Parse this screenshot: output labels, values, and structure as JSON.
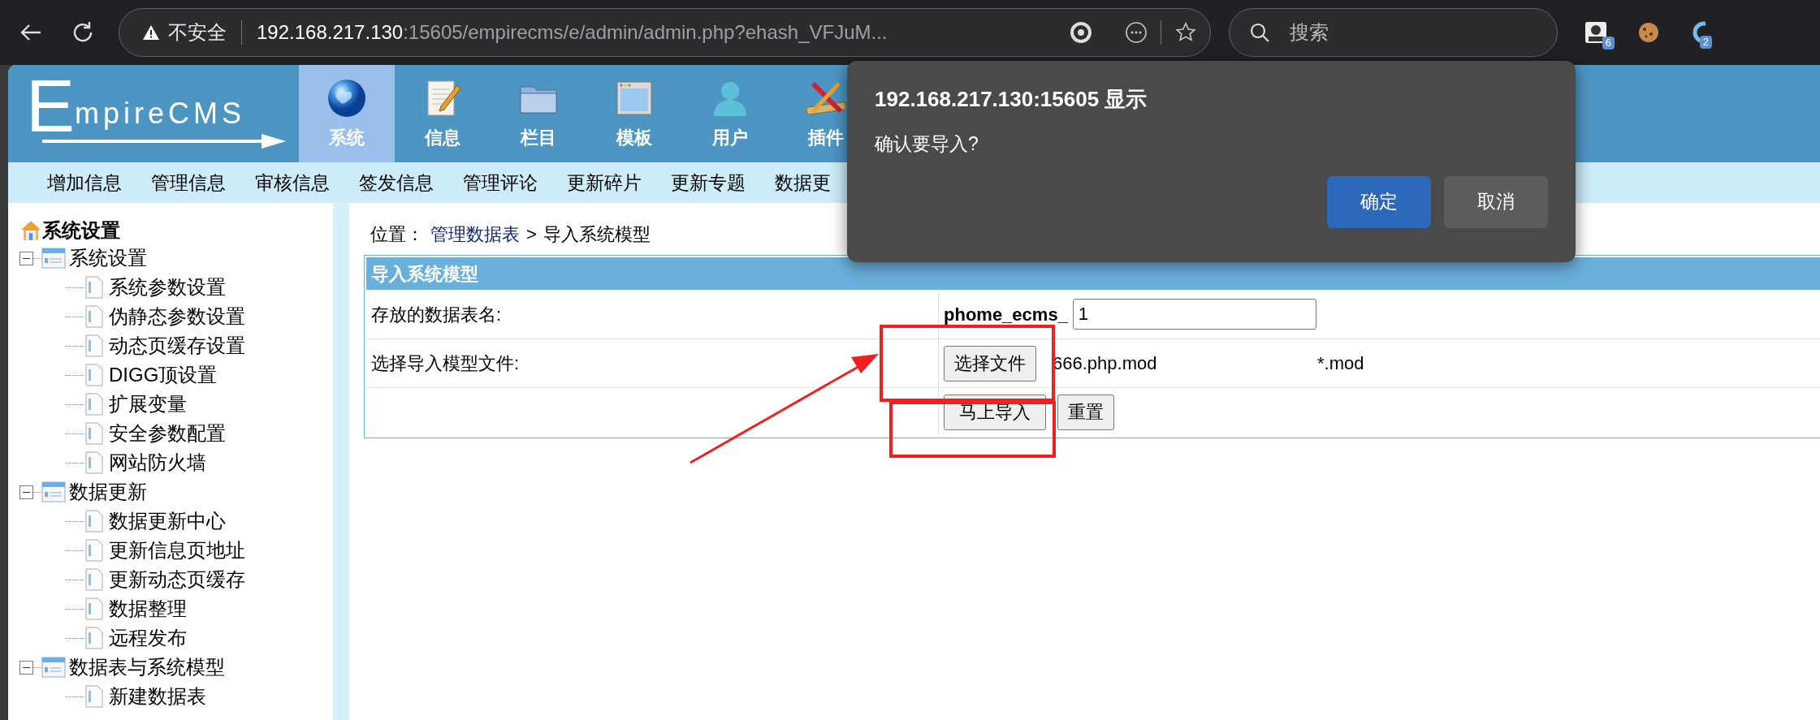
{
  "browser": {
    "security_label": "不安全",
    "url_host": "192.168.217.130",
    "url_rest": ":15605/empirecms/e/admin/admin.php?ehash_VFJuM...",
    "search_placeholder": "搜索",
    "extensions": [
      {
        "kind": "profile",
        "badge": "6"
      },
      {
        "kind": "cookie"
      },
      {
        "kind": "ring",
        "badge": "2"
      }
    ]
  },
  "header": {
    "logo_first": "E",
    "logo_rest": "mpireCMS",
    "tabs": [
      {
        "label": "系统",
        "kind": "globe",
        "selected": true
      },
      {
        "label": "信息",
        "kind": "notepad",
        "selected": false
      },
      {
        "label": "栏目",
        "kind": "folder",
        "selected": false
      },
      {
        "label": "模板",
        "kind": "window",
        "selected": false
      },
      {
        "label": "用户",
        "kind": "user",
        "selected": false
      },
      {
        "label": "插件",
        "kind": "tools",
        "selected": false
      }
    ]
  },
  "subnav": [
    "增加信息",
    "管理信息",
    "审核信息",
    "签发信息",
    "管理评论",
    "更新碎片",
    "更新专题",
    "数据更"
  ],
  "sidebar": {
    "title": "系统设置",
    "tree": [
      {
        "label": "系统设置",
        "expanded": true,
        "children": [
          {
            "label": "系统参数设置"
          },
          {
            "label": "伪静态参数设置"
          },
          {
            "label": "动态页缓存设置"
          },
          {
            "label": "DIGG顶设置"
          },
          {
            "label": "扩展变量"
          },
          {
            "label": "安全参数配置"
          },
          {
            "label": "网站防火墙"
          }
        ]
      },
      {
        "label": "数据更新",
        "expanded": true,
        "children": [
          {
            "label": "数据更新中心"
          },
          {
            "label": "更新信息页地址"
          },
          {
            "label": "更新动态页缓存"
          },
          {
            "label": "数据整理"
          },
          {
            "label": "远程发布"
          }
        ]
      },
      {
        "label": "数据表与系统模型",
        "expanded": true,
        "children": [
          {
            "label": "新建数据表"
          }
        ]
      }
    ]
  },
  "breadcrumb": {
    "prefix": "位置：",
    "link": "管理数据表",
    "separator": ">",
    "current": "导入系统模型"
  },
  "form": {
    "title": "导入系统模型",
    "rows": [
      {
        "kind": "table_name",
        "label": "存放的数据表名:",
        "prefix": "phome_ecms_",
        "value": "1"
      },
      {
        "kind": "file",
        "label": "选择导入模型文件:",
        "button": "选择文件",
        "file_name": "666.php.mod",
        "hint": "*.mod"
      },
      {
        "kind": "actions",
        "buttons": [
          "马上导入",
          "重置"
        ]
      }
    ]
  },
  "dialog": {
    "title": "192.168.217.130:15605 显示",
    "message": "确认要导入?",
    "buttons": [
      {
        "label": "确定",
        "kind": "primary"
      },
      {
        "label": "取消",
        "kind": "secondary"
      }
    ]
  }
}
